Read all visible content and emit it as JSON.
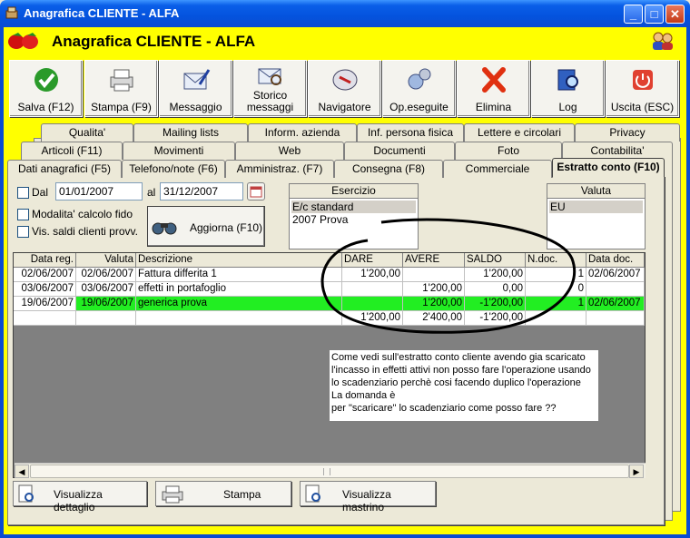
{
  "window": {
    "title": "Anagrafica CLIENTE - ALFA"
  },
  "header": {
    "title": "Anagrafica CLIENTE - ALFA"
  },
  "toolbar": [
    {
      "label": "Salva (F12)",
      "icon": "check-icon"
    },
    {
      "label": "Stampa (F9)",
      "icon": "printer-icon"
    },
    {
      "label": "Messaggio",
      "icon": "envelope-pen-icon"
    },
    {
      "label": "Storico messaggi",
      "icon": "envelope-search-icon"
    },
    {
      "label": "Navigatore",
      "icon": "compass-icon"
    },
    {
      "label": "Op.eseguite",
      "icon": "gears-icon"
    },
    {
      "label": "Elimina",
      "icon": "delete-x-icon"
    },
    {
      "label": "Log",
      "icon": "book-search-icon"
    },
    {
      "label": "Uscita (ESC)",
      "icon": "power-icon"
    }
  ],
  "tabs": {
    "row1": [
      "Qualita'",
      "Mailing lists",
      "Inform. azienda",
      "Inf. persona fisica",
      "Lettere e circolari",
      "Privacy"
    ],
    "row2": [
      "Articoli (F11)",
      "Movimenti",
      "Web",
      "Documenti",
      "Foto",
      "Contabilita'"
    ],
    "row3": [
      "Dati anagrafici (F5)",
      "Telefono/note (F6)",
      "Amministraz. (F7)",
      "Consegna (F8)",
      "Commerciale",
      "Estratto conto (F10)"
    ]
  },
  "filters": {
    "dal_label": "Dal",
    "dal_value": "01/01/2007",
    "al_label": "al",
    "al_value": "31/12/2007",
    "modalita_label": "Modalita' calcolo fido",
    "vis_saldi_label": "Vis. saldi clienti provv.",
    "aggiorna_label": "Aggiorna (F10)"
  },
  "esercizio": {
    "title": "Esercizio",
    "items": [
      "E/c standard",
      "2007 Prova"
    ]
  },
  "valuta": {
    "title": "Valuta",
    "items": [
      "EU"
    ]
  },
  "grid": {
    "columns": [
      "Data reg.",
      "Valuta",
      "Descrizione",
      "DARE",
      "AVERE",
      "SALDO",
      "N.doc.",
      "Data doc."
    ],
    "rows": [
      {
        "data_reg": "02/06/2007",
        "valuta": "02/06/2007",
        "descrizione": "Fattura differita 1",
        "dare": "1'200,00",
        "avere": "",
        "saldo": "1'200,00",
        "ndoc": "1",
        "data_doc": "02/06/2007"
      },
      {
        "data_reg": "03/06/2007",
        "valuta": "03/06/2007",
        "descrizione": "effetti in portafoglio",
        "dare": "",
        "avere": "1'200,00",
        "saldo": "0,00",
        "ndoc": "0",
        "data_doc": ""
      },
      {
        "data_reg": "19/06/2007",
        "valuta": "19/06/2007",
        "descrizione": "generica prova",
        "dare": "",
        "avere": "1'200,00",
        "saldo": "-1'200,00",
        "ndoc": "1",
        "data_doc": "02/06/2007"
      }
    ],
    "totals": {
      "dare": "1'200,00",
      "avere": "2'400,00",
      "saldo": "-1'200,00"
    },
    "highlight_color": "#22ee22"
  },
  "note": {
    "lines": [
      "Come vedi sull'estratto conto cliente avendo gia scaricato",
      "l'incasso in effetti attivi non posso fare l'operazione usando",
      "lo scadenziario perchè cosi facendo duplico l'operazione",
      "La domanda è",
      "per \"scaricare\"  lo scadenziario come posso fare ??"
    ]
  },
  "bottom_buttons": [
    {
      "label": "Visualizza dettaglio"
    },
    {
      "label": "Stampa"
    },
    {
      "label": "Visualizza mastrino"
    }
  ],
  "colors": {
    "frame": "#ffff00",
    "titlebar": "#0a5fe8"
  }
}
